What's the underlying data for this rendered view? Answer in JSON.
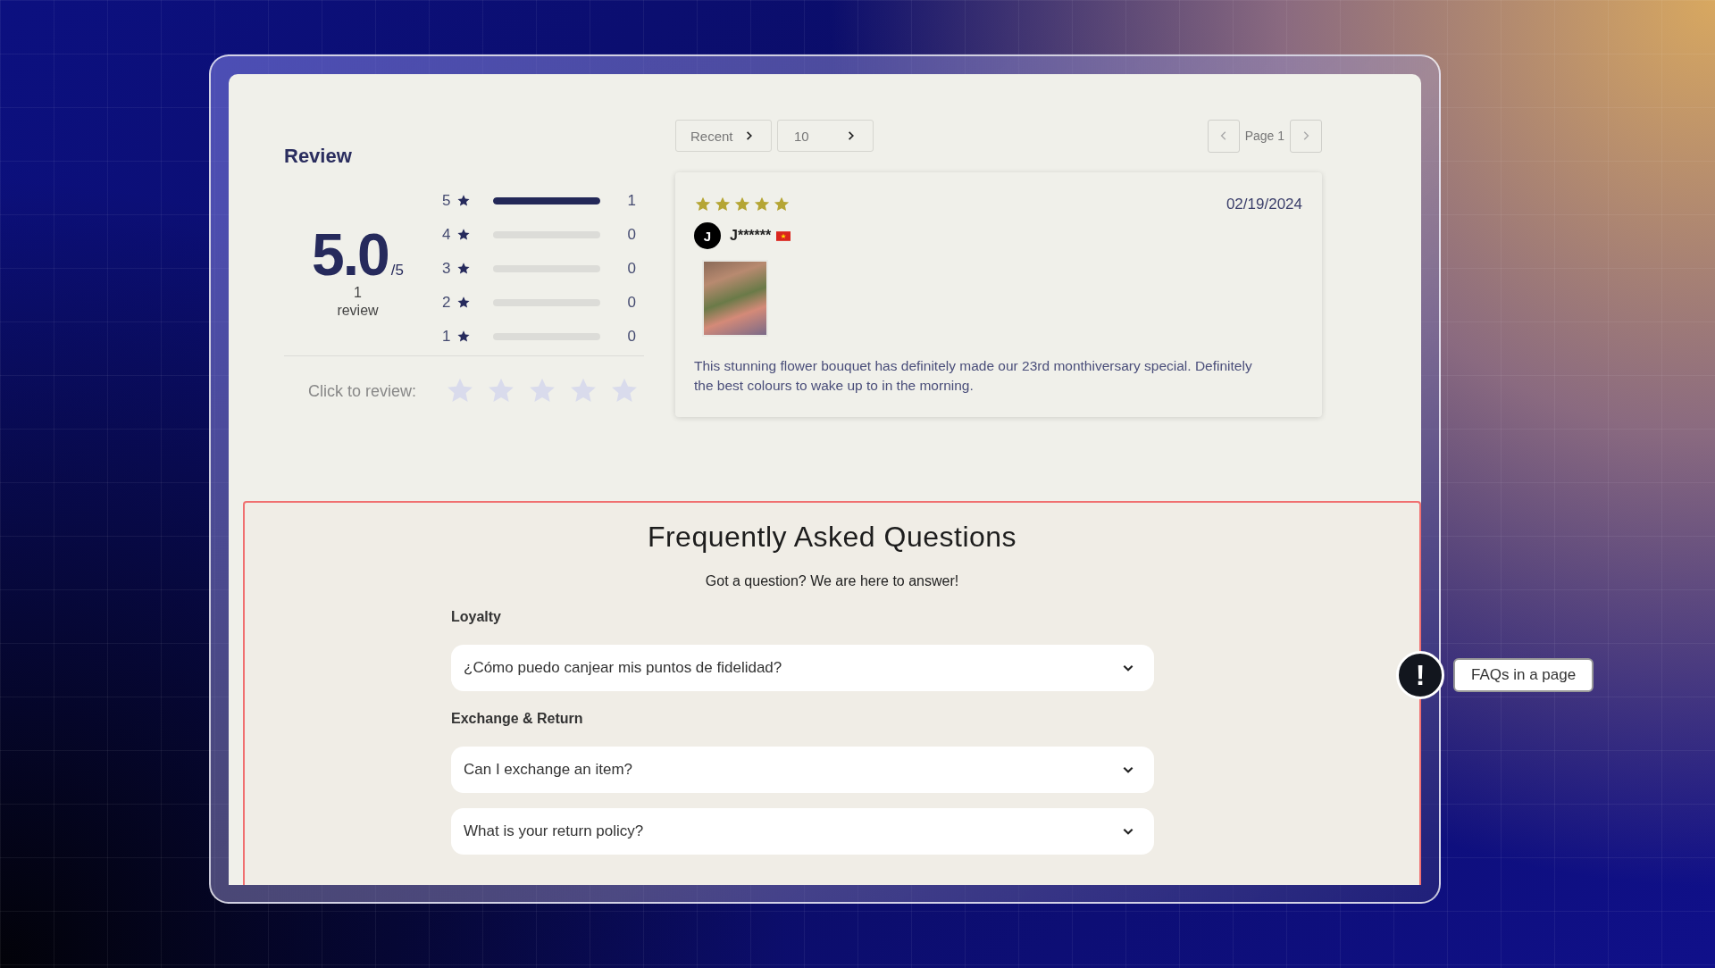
{
  "review": {
    "title": "Review",
    "score": "5.0",
    "score_max": "/5",
    "review_count": "1",
    "review_count_label": "review",
    "breakdown": [
      {
        "rating": "5",
        "level": 1,
        "count": "1"
      },
      {
        "rating": "4",
        "level": 0,
        "count": "0"
      },
      {
        "rating": "3",
        "level": 0,
        "count": "0"
      },
      {
        "rating": "2",
        "level": 0,
        "count": "0"
      },
      {
        "rating": "1",
        "level": 0,
        "count": "0"
      }
    ],
    "click_to_review": {
      "label": "Click to review:",
      "stars": 0
    }
  },
  "controls": {
    "sort": "Recent",
    "per_page": "10",
    "page": "Page 1"
  },
  "review_card": {
    "stars": 5,
    "date": "02/19/2024",
    "avatar_letter": "J",
    "author": "J******",
    "text": "This stunning flower bouquet has definitely made our 23rd monthiversary special. Definitely the best colours to wake up to in the morning."
  },
  "faq": {
    "title": "Frequently Asked Questions",
    "subtitle": "Got a question? We are here to answer!",
    "groups": [
      {
        "label": "Loyalty",
        "questions": [
          {
            "text": "¿Cómo puedo canjear mis puntos de fidelidad?",
            "expanded": false
          }
        ]
      },
      {
        "label": "Exchange & Return",
        "questions": [
          {
            "text": "Can I exchange an item?",
            "expanded": false
          },
          {
            "text": "What is your return policy?",
            "expanded": false
          }
        ]
      }
    ]
  },
  "callout": {
    "icon": "!",
    "label": "FAQs in a page"
  }
}
